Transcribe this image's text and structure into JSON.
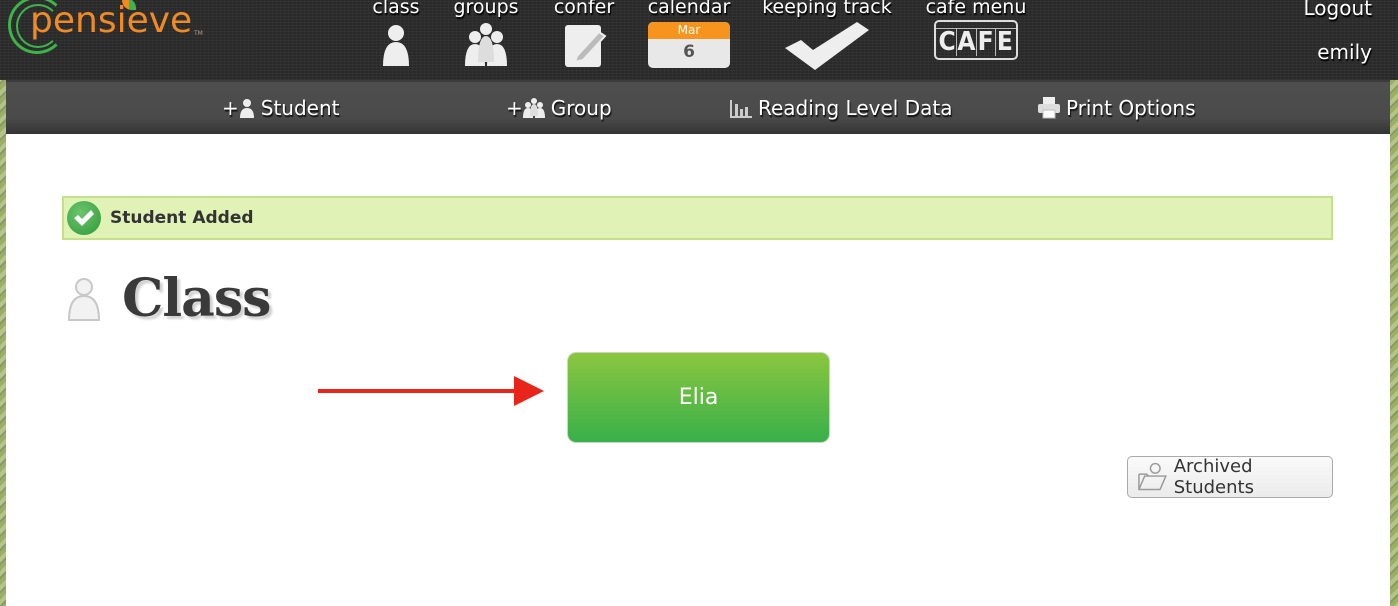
{
  "brand": {
    "name": "pensieve",
    "trademark": "TM"
  },
  "nav": [
    {
      "label": "class",
      "icon": "person-icon"
    },
    {
      "label": "groups",
      "icon": "group-icon"
    },
    {
      "label": "confer",
      "icon": "notepad-pencil-icon"
    },
    {
      "label": "calendar",
      "icon": "calendar-icon",
      "month": "Mar",
      "day": "6"
    },
    {
      "label": "keeping track",
      "icon": "checkmark-icon"
    },
    {
      "label": "cafe menu",
      "icon": "cafe-icon",
      "letters": [
        "C",
        "A",
        "F",
        "E"
      ]
    }
  ],
  "user": {
    "logout_label": "Logout",
    "username": "emily"
  },
  "subnav": {
    "add_student": "Student",
    "add_group": "Group",
    "reading_level": "Reading Level Data",
    "print_options": "Print Options",
    "plus": "+"
  },
  "alert": {
    "text": "Student Added",
    "type": "success"
  },
  "page": {
    "title": "Class"
  },
  "students": [
    {
      "name": "Elia"
    }
  ],
  "archived_button": "Archived Students",
  "colors": {
    "brand_orange": "#f08a24",
    "brand_green": "#3eb34a",
    "alert_bg": "#e0f2b5",
    "student_card_top": "#8cc63f",
    "student_card_bottom": "#38b04a",
    "annotation_arrow": "#e8251a",
    "calendar_month": "#f7941d"
  }
}
